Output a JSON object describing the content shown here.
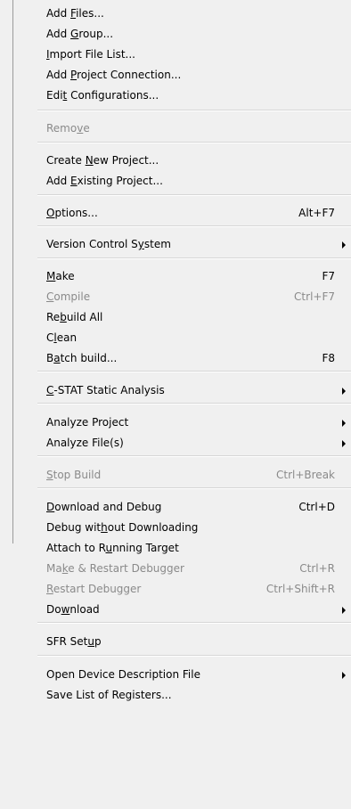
{
  "menu": {
    "items": [
      {
        "pre": "Add ",
        "ul": "F",
        "post": "iles...",
        "shortcut": "",
        "submenu": false,
        "disabled": false
      },
      {
        "pre": "Add ",
        "ul": "G",
        "post": "roup...",
        "shortcut": "",
        "submenu": false,
        "disabled": false
      },
      {
        "pre": "",
        "ul": "I",
        "post": "mport File List...",
        "shortcut": "",
        "submenu": false,
        "disabled": false
      },
      {
        "pre": "Add ",
        "ul": "P",
        "post": "roject Connection...",
        "shortcut": "",
        "submenu": false,
        "disabled": false
      },
      {
        "pre": "Edi",
        "ul": "t",
        "post": " Configurations...",
        "shortcut": "",
        "submenu": false,
        "disabled": false
      },
      {
        "pre": "Remo",
        "ul": "v",
        "post": "e",
        "shortcut": "",
        "submenu": false,
        "disabled": true
      },
      {
        "pre": "Create ",
        "ul": "N",
        "post": "ew Project...",
        "shortcut": "",
        "submenu": false,
        "disabled": false
      },
      {
        "pre": "Add ",
        "ul": "E",
        "post": "xisting Project...",
        "shortcut": "",
        "submenu": false,
        "disabled": false
      },
      {
        "pre": "",
        "ul": "O",
        "post": "ptions...",
        "shortcut": "Alt+F7",
        "submenu": false,
        "disabled": false
      },
      {
        "pre": "Version Control S",
        "ul": "y",
        "post": "stem",
        "shortcut": "",
        "submenu": true,
        "disabled": false
      },
      {
        "pre": "",
        "ul": "M",
        "post": "ake",
        "shortcut": "F7",
        "submenu": false,
        "disabled": false
      },
      {
        "pre": "",
        "ul": "C",
        "post": "ompile",
        "shortcut": "Ctrl+F7",
        "submenu": false,
        "disabled": true
      },
      {
        "pre": "Re",
        "ul": "b",
        "post": "uild All",
        "shortcut": "",
        "submenu": false,
        "disabled": false
      },
      {
        "pre": "C",
        "ul": "l",
        "post": "ean",
        "shortcut": "",
        "submenu": false,
        "disabled": false
      },
      {
        "pre": "B",
        "ul": "a",
        "post": "tch build...",
        "shortcut": "F8",
        "submenu": false,
        "disabled": false
      },
      {
        "pre": "",
        "ul": "C",
        "post": "-STAT Static Analysis",
        "shortcut": "",
        "submenu": true,
        "disabled": false
      },
      {
        "pre": "Analyze Project",
        "ul": "",
        "post": "",
        "shortcut": "",
        "submenu": true,
        "disabled": false
      },
      {
        "pre": "Analyze File(s)",
        "ul": "",
        "post": "",
        "shortcut": "",
        "submenu": true,
        "disabled": false
      },
      {
        "pre": "",
        "ul": "S",
        "post": "top Build",
        "shortcut": "Ctrl+Break",
        "submenu": false,
        "disabled": true
      },
      {
        "pre": "",
        "ul": "D",
        "post": "ownload and Debug",
        "shortcut": "Ctrl+D",
        "submenu": false,
        "disabled": false
      },
      {
        "pre": "Debug wit",
        "ul": "h",
        "post": "out Downloading",
        "shortcut": "",
        "submenu": false,
        "disabled": false
      },
      {
        "pre": "Attach to R",
        "ul": "u",
        "post": "nning Target",
        "shortcut": "",
        "submenu": false,
        "disabled": false
      },
      {
        "pre": "Ma",
        "ul": "k",
        "post": "e & Restart Debugger",
        "shortcut": "Ctrl+R",
        "submenu": false,
        "disabled": true
      },
      {
        "pre": "",
        "ul": "R",
        "post": "estart Debugger",
        "shortcut": "Ctrl+Shift+R",
        "submenu": false,
        "disabled": true
      },
      {
        "pre": "Do",
        "ul": "w",
        "post": "nload",
        "shortcut": "",
        "submenu": true,
        "disabled": false
      },
      {
        "pre": "SFR Set",
        "ul": "u",
        "post": "p",
        "shortcut": "",
        "submenu": false,
        "disabled": false
      },
      {
        "pre": "Open Device Description File",
        "ul": "",
        "post": "",
        "shortcut": "",
        "submenu": true,
        "disabled": false
      },
      {
        "pre": "Save List of Registers...",
        "ul": "",
        "post": "",
        "shortcut": "",
        "submenu": false,
        "disabled": false
      }
    ]
  }
}
